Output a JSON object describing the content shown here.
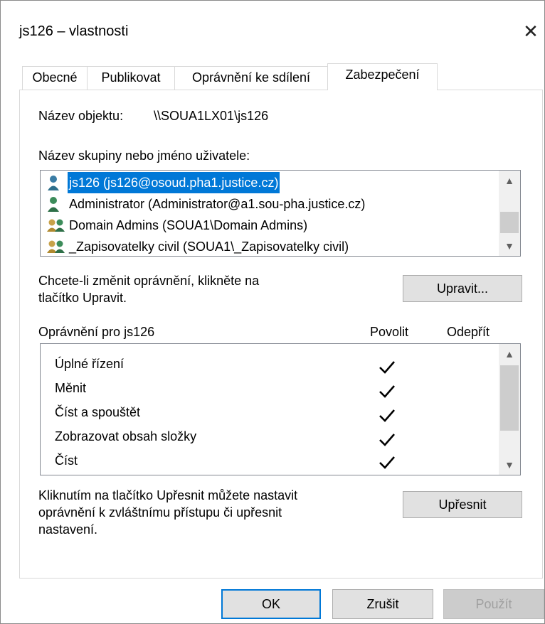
{
  "window": {
    "title": "js126 – vlastnosti",
    "close_label": "✕"
  },
  "tabs": [
    {
      "label": "Obecné"
    },
    {
      "label": "Publikovat"
    },
    {
      "label": "Oprávnění ke sdílení"
    },
    {
      "label": "Zabezpečení",
      "active": true
    }
  ],
  "security": {
    "object_name_label": "Název objektu:",
    "object_name_value": "\\\\SOUA1LX01\\js126",
    "group_label": "Název skupiny nebo jméno uživatele:",
    "users": [
      {
        "name": "js126 (js126@osoud.pha1.justice.cz)",
        "icon": "user-icon",
        "selected": true
      },
      {
        "name": "Administrator (Administrator@a1.sou-pha.justice.cz)",
        "icon": "user-icon"
      },
      {
        "name": "Domain Admins (SOUA1\\Domain Admins)",
        "icon": "group-icon"
      },
      {
        "name": "_Zapisovatelky civil (SOUA1\\_Zapisovatelky civil)",
        "icon": "group-icon"
      }
    ],
    "edit_hint_line1": "Chcete-li změnit oprávnění, klikněte na",
    "edit_hint_line2": "tlačítko Upravit.",
    "edit_button": "Upravit...",
    "perm_header": "Oprávnění pro js126",
    "allow_header": "Povolit",
    "deny_header": "Odepřít",
    "permissions": [
      {
        "name": "Úplné řízení",
        "allow": true,
        "deny": false
      },
      {
        "name": "Měnit",
        "allow": true,
        "deny": false
      },
      {
        "name": "Číst a spouštět",
        "allow": true,
        "deny": false
      },
      {
        "name": "Zobrazovat obsah složky",
        "allow": true,
        "deny": false
      },
      {
        "name": "Číst",
        "allow": true,
        "deny": false
      }
    ],
    "advanced_hint_line1": "Kliknutím na tlačítko Upřesnit můžete nastavit",
    "advanced_hint_line2": "oprávnění k zvláštnímu přístupu či upřesnit",
    "advanced_hint_line3": "nastavení.",
    "advanced_button": "Upřesnit"
  },
  "footer": {
    "ok": "OK",
    "cancel": "Zrušit",
    "apply": "Použít"
  },
  "colors": {
    "selection": "#0078d7",
    "default_border": "#0078d7",
    "user_icon": "#2e7d8c",
    "group_icon": "#c8a24a"
  }
}
